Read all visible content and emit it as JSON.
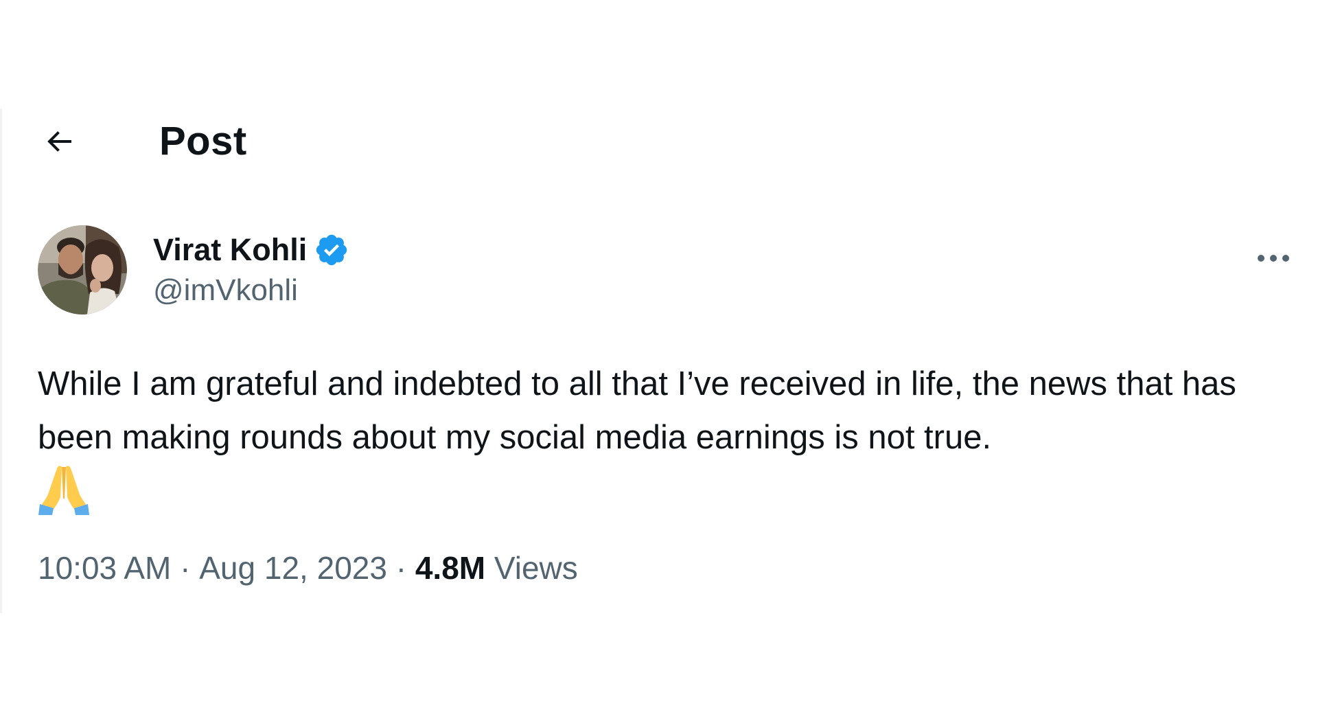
{
  "header": {
    "back_icon": "arrow-left-icon",
    "title": "Post"
  },
  "author": {
    "avatar_icon": "profile-photo",
    "display_name": "Virat Kohli",
    "verified_icon": "verified-badge-icon",
    "handle": "@imVkohli",
    "more_icon": "more-horizontal-icon"
  },
  "tweet": {
    "text": "While I am grateful and indebted to all that I’ve received in life, the news that has been making rounds about my social media earnings is not true.",
    "emoji": "folded-hands-emoji"
  },
  "meta": {
    "time": "10:03 AM",
    "separator": " · ",
    "date": "Aug 12, 2023",
    "views_count": "4.8M",
    "views_label": "Views"
  },
  "colors": {
    "text_primary": "#0f1419",
    "text_secondary": "#536471",
    "verified_blue": "#1d9bf0",
    "divider": "#eff3f4"
  }
}
